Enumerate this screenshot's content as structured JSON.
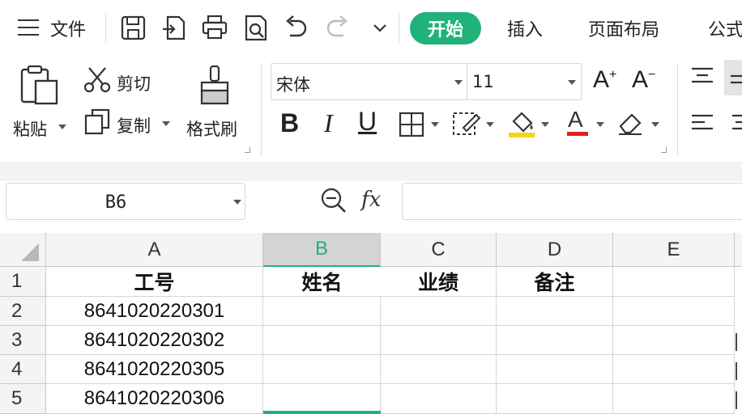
{
  "menu": {
    "file_label": "文件",
    "tabs": [
      "开始",
      "插入",
      "页面布局",
      "公式"
    ],
    "active_tab": "开始",
    "accent_color": "#1fb37a"
  },
  "quick_access": [
    "save-icon",
    "export-icon",
    "print-icon",
    "print-preview-icon",
    "undo-icon",
    "redo-icon",
    "more-dropdown-icon"
  ],
  "ribbon": {
    "paste_label": "粘贴",
    "cut_label": "剪切",
    "copy_label": "复制",
    "format_painter_label": "格式刷",
    "font_name": "宋体",
    "font_size": "11",
    "grow_font": "A",
    "shrink_font": "A",
    "bold": "B",
    "italic": "I",
    "underline": "U",
    "font_color_glyph": "A"
  },
  "formula_bar": {
    "name_box": "B6",
    "fx_label": "fx",
    "formula": ""
  },
  "sheet": {
    "columns": [
      "A",
      "B",
      "C",
      "D",
      "E"
    ],
    "active_column": "B",
    "rows": [
      {
        "num": "1",
        "cells": [
          "工号",
          "姓名",
          "业绩",
          "备注",
          ""
        ]
      },
      {
        "num": "2",
        "cells": [
          "8641020220301",
          "",
          "",
          "",
          ""
        ]
      },
      {
        "num": "3",
        "cells": [
          "8641020220302",
          "",
          "",
          "",
          ""
        ]
      },
      {
        "num": "4",
        "cells": [
          "8641020220305",
          "",
          "",
          "",
          ""
        ]
      },
      {
        "num": "5",
        "cells": [
          "8641020220306",
          "",
          "",
          "",
          ""
        ]
      }
    ]
  }
}
